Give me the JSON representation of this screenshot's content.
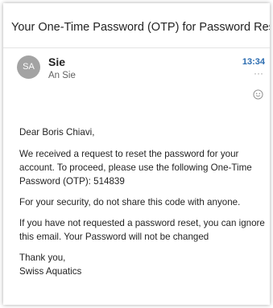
{
  "email": {
    "subject": "Your One-Time Password (OTP) for Password Reset",
    "sender": {
      "initials": "SA",
      "name": "Sie",
      "recipient_line": "An Sie"
    },
    "time": "13:34",
    "icons": {
      "more": "more-options-icon",
      "reaction": "smiley-icon"
    },
    "body": {
      "greeting": "Dear Boris Chiavi,",
      "paragraph1": "We received a request to reset the password for your account. To proceed, please use the following One-Time Password (OTP): 514839",
      "paragraph2": "For your security, do not share this code with anyone.",
      "paragraph3": "If you have not requested a password reset, you can ignore this email. Your Password will not be changed",
      "closing": "Thank you,",
      "signature": "Swiss Aquatics"
    }
  },
  "colors": {
    "time_accent": "#2b6cb0",
    "avatar_bg": "#a3a3a3",
    "text": "#242424"
  }
}
